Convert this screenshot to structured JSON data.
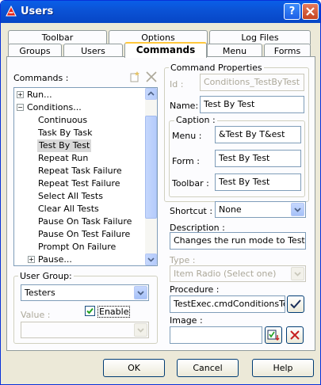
{
  "window": {
    "title": "Users"
  },
  "tabs_row1": [
    "Toolbar",
    "Options",
    "Log Files"
  ],
  "tabs_row2": [
    "Groups",
    "Users",
    "Commands",
    "Menu",
    "Forms"
  ],
  "commands": {
    "label": "Commands :",
    "tree": [
      {
        "text": "Run...",
        "level": 0,
        "expander": "+"
      },
      {
        "text": "Conditions...",
        "level": 0,
        "expander": "−"
      },
      {
        "text": "Continuous",
        "level": 1
      },
      {
        "text": "Task By Task",
        "level": 1
      },
      {
        "text": "Test By Test",
        "level": 1,
        "selected": true
      },
      {
        "text": "Repeat Run",
        "level": 1
      },
      {
        "text": "Repeat Task Failure",
        "level": 1
      },
      {
        "text": "Repeat Test Failure",
        "level": 1
      },
      {
        "text": "Select All Tests",
        "level": 1
      },
      {
        "text": "Clear All Tests",
        "level": 1
      },
      {
        "text": "Pause On Task Failure",
        "level": 1
      },
      {
        "text": "Pause On Test Failure",
        "level": 1
      },
      {
        "text": "Prompt On Failure",
        "level": 1
      },
      {
        "text": "Pause...",
        "level": 1,
        "expander": "+"
      }
    ]
  },
  "user_group": {
    "title": "User Group:",
    "selected": "Testers",
    "value_label": "Value :",
    "enable_label": "Enable",
    "enable_checked": true
  },
  "props": {
    "title": "Command Properties",
    "id_label": "Id :",
    "id_value": "Conditions_TestByTest",
    "name_label": "Name:",
    "name_value": "Test By Test",
    "caption_title": "Caption :",
    "menu_label": "Menu :",
    "menu_value": "&Test By T&est",
    "form_label": "Form :",
    "form_value": "Test By Test",
    "toolbar_label": "Toolbar :",
    "toolbar_value": "Test By Test",
    "shortcut_label": "Shortcut :",
    "shortcut_value": "None",
    "description_label": "Description :",
    "description_value": "Changes the run mode to Test By",
    "type_label": "Type :",
    "type_value": "Item Radio (Select one)",
    "procedure_label": "Procedure :",
    "procedure_value": "TestExec.cmdConditionsTes",
    "image_label": "Image :",
    "image_value": ""
  },
  "buttons": {
    "ok": "OK",
    "cancel": "Cancel",
    "help": "Help"
  },
  "colors": {
    "title_bar": "#0b53d6",
    "active_tab": "#ffc83c",
    "delete_red": "#c62020",
    "check_green": "#21a121"
  }
}
